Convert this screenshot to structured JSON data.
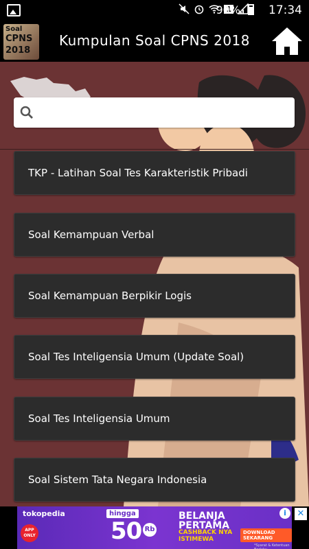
{
  "status_bar": {
    "battery_percent": "90%",
    "time": "17:34",
    "sim_indicator": "1"
  },
  "app_bar": {
    "logo": {
      "line1": "Soal",
      "line2": "CPNS",
      "line3": "2018"
    },
    "title": "Kumpulan Soal CPNS 2018",
    "home_icon": "home-icon"
  },
  "search": {
    "placeholder": "",
    "value": "",
    "icon": "search-icon"
  },
  "menu_items": [
    {
      "label": "TKP - Latihan Soal Tes Karakteristik Pribadi"
    },
    {
      "label": "Soal Kemampuan Verbal"
    },
    {
      "label": "Soal Kemampuan Berpikir Logis"
    },
    {
      "label": "Soal Tes Inteligensia Umum (Update Soal)"
    },
    {
      "label": "Soal Tes Inteligensia Umum"
    },
    {
      "label": "Soal Sistem Tata Negara Indonesia"
    }
  ],
  "ad_banner": {
    "brand": "tokopedia",
    "badge": "APP ONLY",
    "hingga": "hingga",
    "amount": "50",
    "unit": "Rb",
    "line1": "BELANJA",
    "line2": "PERTAMA",
    "line3": "CASHBACK NYA",
    "line4": "ISTIMEWA",
    "cta": "DOWNLOAD SEKARANG",
    "fine_print": "*Syarat & Ketentuan Berlaku"
  },
  "colors": {
    "background_maroon": "#6b3334",
    "card": "#2c2c2c",
    "app_bar": "#000000",
    "ad_purple": "#6a30c6"
  }
}
